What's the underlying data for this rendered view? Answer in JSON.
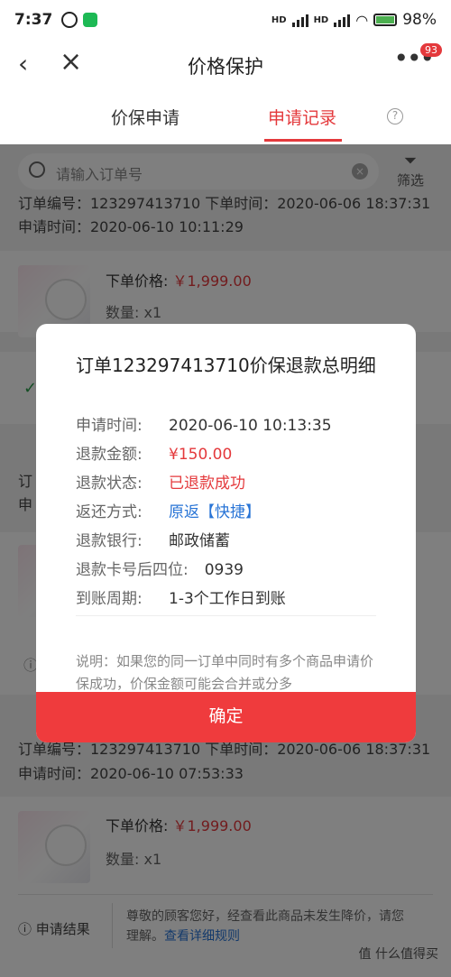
{
  "status": {
    "time": "7:37",
    "battery": "98%",
    "network_1": "HD",
    "network_2": "HD"
  },
  "nav": {
    "title": "价格保护",
    "badge": "93"
  },
  "tabs": [
    {
      "label": "价保申请"
    },
    {
      "label": "申请记录"
    }
  ],
  "search": {
    "placeholder": "请输入订单号",
    "filter_label": "筛选"
  },
  "list": {
    "top_order_line": "订单编号：123297413710  下单时间：2020-06-06 18:37:31",
    "top_apply_time": "申请时间：2020-06-10 10:11:29",
    "item_price_label": "下单价格:",
    "item_price_value": "￥1,999.00",
    "item_qty": "数量: x1",
    "second_order_line": "订单编号：123297413710  下单时间：2020-06-06 18:37:31",
    "second_apply_time": "申请时间：2020-06-10 07:53:33",
    "result_label": "申请结果",
    "result_text": "尊敬的顾客您好，经查看此商品未发生降价，请您理解。",
    "result_link": "查看详细规则",
    "partial_left_1": "订",
    "partial_left_2": "申"
  },
  "dialog": {
    "title": "订单123297413710价保退款总明细",
    "rows": [
      {
        "key": "申请时间:",
        "value": "2020-06-10 10:13:35"
      },
      {
        "key": "退款金额:",
        "value": "¥150.00"
      },
      {
        "key": "退款状态:",
        "value": "已退款成功"
      },
      {
        "key": "返还方式:",
        "value": "原返【快捷】"
      },
      {
        "key": "退款银行:",
        "value": "邮政储蓄"
      },
      {
        "key": "退款卡号后四位:",
        "value": "0939"
      },
      {
        "key": "到账周期:",
        "value": "1-3个工作日到账"
      }
    ],
    "note": "说明：如果您的同一订单中同时有多个商品申请价保成功，价保金额可能会合并或分多",
    "confirm_label": "确定"
  },
  "watermark": "值 什么值得买",
  "colors": {
    "accent": "#e4393c",
    "link": "#2874d6",
    "button": "#ef3b3d"
  }
}
